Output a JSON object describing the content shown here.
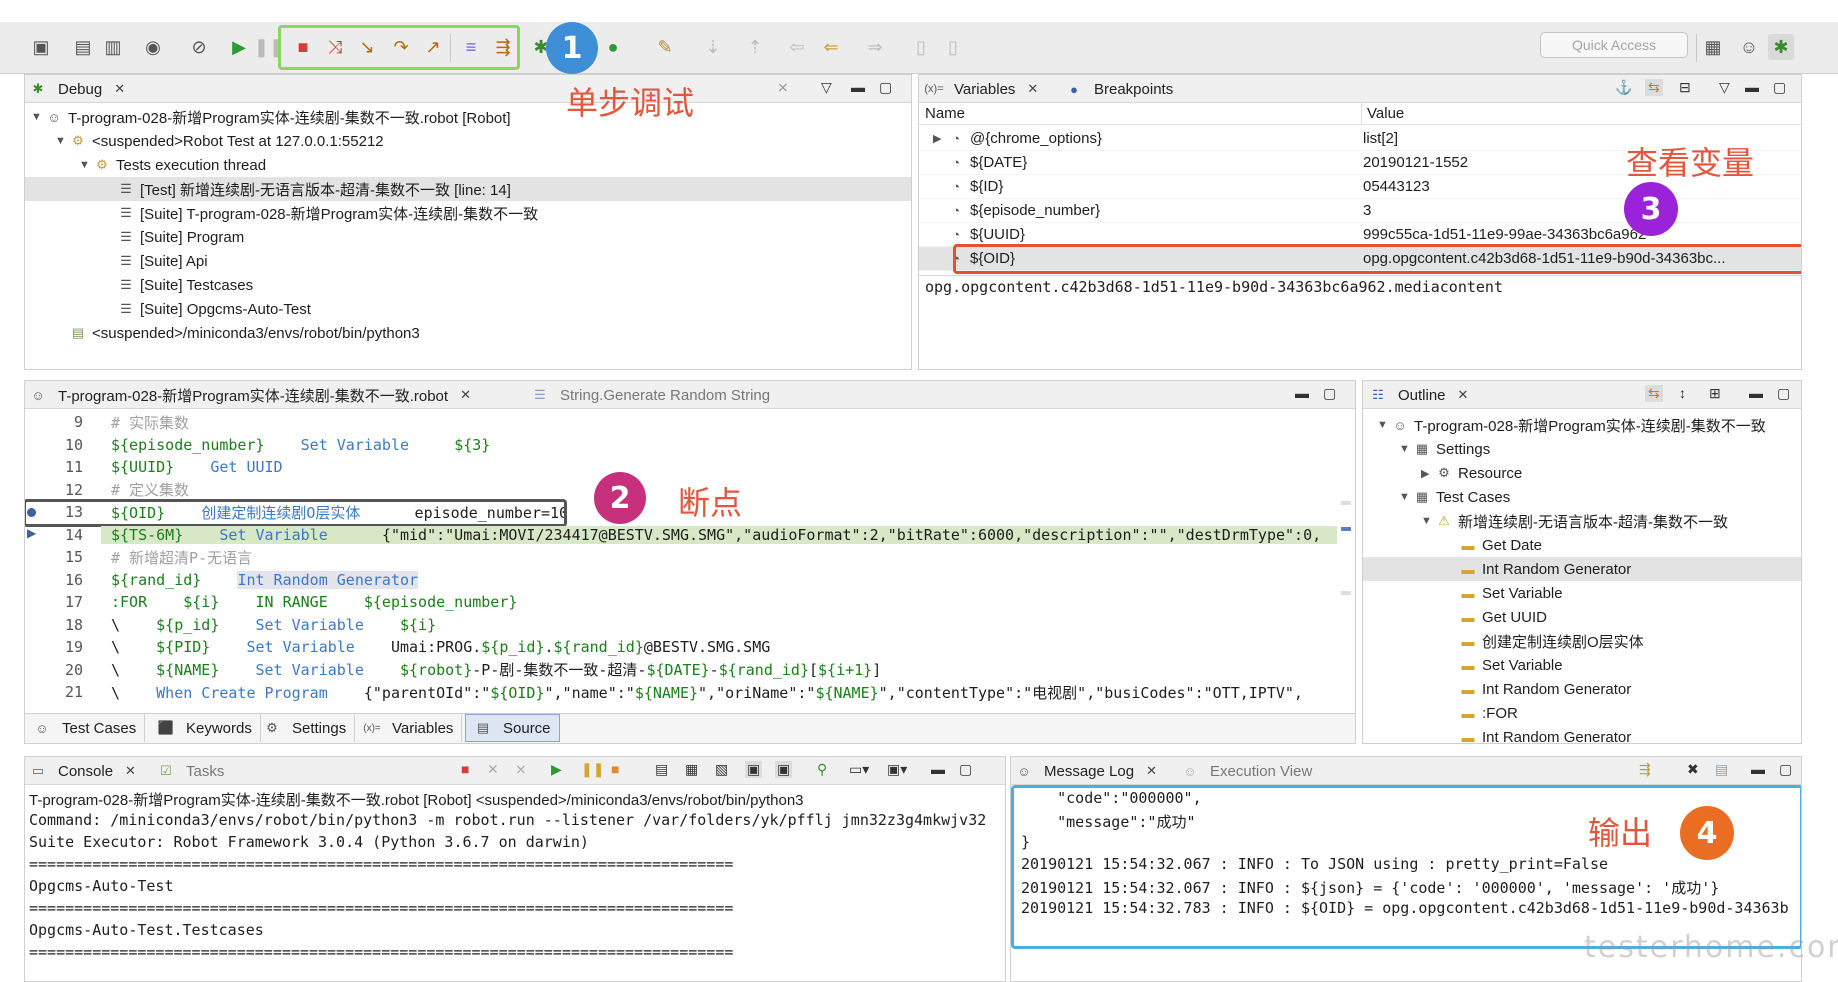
{
  "toolbar": {
    "quick_access_placeholder": "Quick Access"
  },
  "debug_view": {
    "tab_label": "Debug",
    "tree": [
      "T-program-028-新增Program实体-连续剧-集数不一致.robot [Robot]",
      "<suspended>Robot Test at 127.0.0.1:55212",
      "Tests execution thread",
      "[Test] 新增连续剧-无语言版本-超清-集数不一致 [line: 14]",
      "[Suite] T-program-028-新增Program实体-连续剧-集数不一致",
      "[Suite] Program",
      "[Suite] Api",
      "[Suite] Testcases",
      "[Suite] Opgcms-Auto-Test",
      "<suspended>/miniconda3/envs/robot/bin/python3"
    ]
  },
  "variables_view": {
    "tab_variables": "Variables",
    "tab_breakpoints": "Breakpoints",
    "col_name": "Name",
    "col_value": "Value",
    "rows": [
      {
        "name": "@{chrome_options}",
        "value": "list[2]"
      },
      {
        "name": "${DATE}",
        "value": "20190121-1552"
      },
      {
        "name": "${ID}",
        "value": "05443123"
      },
      {
        "name": "${episode_number}",
        "value": "3"
      },
      {
        "name": "${UUID}",
        "value": "999c55ca-1d51-11e9-99ae-34363bc6a962"
      },
      {
        "name": "${OID}",
        "value": "opg.opgcontent.c42b3d68-1d51-11e9-b90d-34363bc..."
      }
    ],
    "detail": "opg.opgcontent.c42b3d68-1d51-11e9-b90d-34363bc6a962.mediacontent"
  },
  "editor": {
    "tab_active": "T-program-028-新增Program实体-连续剧-集数不一致.robot",
    "tab_inactive": "String.Generate Random String",
    "lines": [
      {
        "n": "9",
        "text": "# 实际集数"
      },
      {
        "n": "10",
        "text": "${episode_number}    Set Variable     ${3}"
      },
      {
        "n": "11",
        "text": "${UUID}    Get UUID"
      },
      {
        "n": "12",
        "text": "# 定义集数"
      },
      {
        "n": "13",
        "text": "${OID}    创建定制连续剧O层实体      episode_number=10"
      },
      {
        "n": "14",
        "text": "${TS-6M}    Set Variable      {\"mid\":\"Umai:MOVI/234417@BESTV.SMG.SMG\",\"audioFormat\":2,\"bitRate\":6000,\"description\":\"\",\"destDrmType\":0,"
      },
      {
        "n": "15",
        "text": "# 新增超清P-无语言"
      },
      {
        "n": "16",
        "text": "${rand_id}    Int Random Generator"
      },
      {
        "n": "17",
        "text": ":FOR    ${i}    IN RANGE    ${episode_number}"
      },
      {
        "n": "18",
        "text": "\\    ${p_id}    Set Variable    ${i}"
      },
      {
        "n": "19",
        "text": "\\    ${PID}    Set Variable    Umai:PROG.${p_id}.${rand_id}@BESTV.SMG.SMG"
      },
      {
        "n": "20",
        "text": "\\    ${NAME}    Set Variable    ${robot}-P-剧-集数不一致-超清-${DATE}-${rand_id}[${i+1}]"
      },
      {
        "n": "21",
        "text": "\\    When Create Program    {\"parentOId\":\"${OID}\",\"name\":\"${NAME}\",\"oriName\":\"${NAME}\",\"contentType\":\"电视剧\",\"busiCodes\":\"OTT,IPTV\","
      }
    ],
    "bottom_tabs": [
      "Test Cases",
      "Keywords",
      "Settings",
      "Variables",
      "Source"
    ]
  },
  "outline": {
    "tab_label": "Outline",
    "tree": [
      "T-program-028-新增Program实体-连续剧-集数不一致",
      "Settings",
      "Resource",
      "Test Cases",
      "新增连续剧-无语言版本-超清-集数不一致",
      "Get Date",
      "Int Random Generator",
      "Set Variable",
      "Get UUID",
      "创建定制连续剧O层实体",
      "Set Variable",
      "Int Random Generator",
      ":FOR",
      "Int Random Generator"
    ]
  },
  "console": {
    "tab_label": "Console",
    "tab_tasks": "Tasks",
    "lines": [
      "T-program-028-新增Program实体-连续剧-集数不一致.robot [Robot] <suspended>/miniconda3/envs/robot/bin/python3",
      "Command: /miniconda3/envs/robot/bin/python3 -m robot.run --listener /var/folders/yk/pfflj jmn32z3g4mkwjv32",
      "Suite Executor: Robot Framework 3.0.4 (Python 3.6.7 on darwin)",
      "==============================================================================",
      "Opgcms-Auto-Test",
      "==============================================================================",
      "Opgcms-Auto-Test.Testcases",
      "=============================================================================="
    ]
  },
  "message_log": {
    "tab_label": "Message Log",
    "tab_exec": "Execution View",
    "lines": [
      "    \"code\":\"000000\",",
      "    \"message\":\"成功\"",
      "}",
      "20190121 15:54:32.067 : INFO : To JSON using : pretty_print=False",
      "20190121 15:54:32.067 : INFO : ${json} = {'code': '000000', 'message': '成功'}",
      "20190121 15:54:32.783 : INFO : ${OID} = opg.opgcontent.c42b3d68-1d51-11e9-b90d-34363b"
    ]
  },
  "annotations": {
    "a1_num": "1",
    "a1_text": "单步调试",
    "a2_num": "2",
    "a2_text": "断点",
    "a3_num": "3",
    "a3_text": "查看变量",
    "a4_num": "4",
    "a4_text": "输出",
    "watermark": "testerhome.com"
  },
  "colors": {
    "badge_blue": "#3f8fd8",
    "badge_magenta": "#c7307c",
    "badge_purple": "#9a22d8",
    "badge_orange": "#ea6d24",
    "anno_text": "#e2563b",
    "step_box": "#86d85b",
    "var_box": "#e6502f",
    "log_box": "#4aaee6",
    "current_line": "#d7e8c7"
  }
}
